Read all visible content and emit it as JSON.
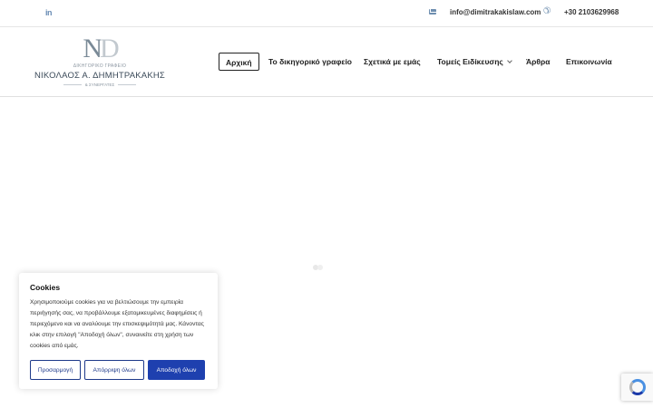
{
  "topbar": {
    "linkedin_icon": "linkedin-icon",
    "email_icon": "envelope-icon",
    "email": "info@dimitrakakislaw.com",
    "phone_icon": "phone-icon",
    "phone": "+30 2103629968"
  },
  "logo": {
    "mark_n": "N",
    "mark_d": "D",
    "subtitle": "ΔΙΚΗΓΟΡΙΚΟ ΓΡΑΦΕΙΟ",
    "name": "ΝΙΚΟΛΑΟΣ Α. ΔΗΜΗΤΡΑΚΑΚΗΣ",
    "tagline": "& ΣΥΝΕΡΓΑΤΕΣ"
  },
  "nav": {
    "items": [
      {
        "label": "Αρχική",
        "active": true
      },
      {
        "label": "Το δικηγορικό γραφείο"
      },
      {
        "label": "Σχετικά με εμάς"
      },
      {
        "label": "Τομείς Ειδίκευσης",
        "dropdown": true
      },
      {
        "label": "Άρθρα"
      },
      {
        "label": "Επικοινωνία"
      }
    ]
  },
  "cookie": {
    "title": "Cookies",
    "text": "Χρησιμοποιούμε cookies για να βελτιώσουμε την εμπειρία περιήγησής σας, να προβάλλουμε εξατομικευμένες διαφημίσεις ή περιεχόμενο και να αναλύουμε την επισκεψιμότητά μας. Κάνοντας κλικ στην επιλογή \"Αποδοχή όλων\", συναινείτε στη χρήση των cookies από εμάς.",
    "customize_label": "Προσαρμογή",
    "reject_label": "Απόρριψη όλων",
    "accept_label": "Αποδοχή όλων",
    "accent_color": "#1e40af"
  },
  "recaptcha": {
    "icon": "recaptcha-icon"
  }
}
